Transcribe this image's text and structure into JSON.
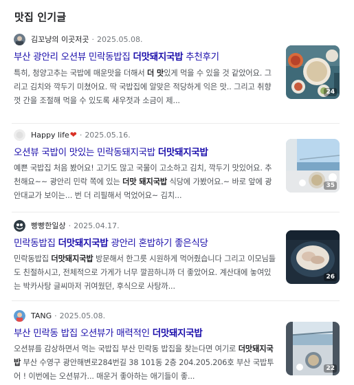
{
  "section": {
    "title": "맛집 인기글"
  },
  "posts": [
    {
      "author": "김꼬냥의 이곳저곳",
      "date": "2025.05.08.",
      "title_parts": [
        "부산 광안리 오션뷰 민락동밥집 ",
        "더맛돼지국밥",
        " 추천후기"
      ],
      "snippet": [
        "특히, 청양고추는 국밥에 매운맛을 더해서 ",
        "더 맛",
        "있게 먹을 수 있을 것 같았어요. 그리고 김치와 깍두기 미쳤어요. 딱 국밥집에 알맞은 적당하게 익은 맛.. 그리고 취향껏 간을 조절해 먹을 수 있도록 새우젓과 소금이 제..."
      ],
      "image_count": "24",
      "thumb_icon": "food-photo-icon"
    },
    {
      "author": "Happy life",
      "date": "2025.05.16.",
      "title_parts": [
        "오션뷰 국밥이 맛있는 민락동돼지국밥 ",
        "더맛돼지국밥",
        ""
      ],
      "snippet": [
        "예쁜 국밥집 처음 봤어요! 고기도 많고 국물이 고소하고 김치, 깍두기 맛있어요. 추천해요~~ 광안리 민락 쪽에 있는 ",
        "더맛 돼지국밥",
        " 식당에 가봤어요.~ 바로 앞에 광안대교가 보이는... 번 더 리필해서 먹었어요~ 김치..."
      ],
      "image_count": "35",
      "thumb_icon": "ocean-view-photo-icon"
    },
    {
      "author": "빵빵한일상",
      "date": "2025.04.17.",
      "title_parts": [
        "민락동밥집 ",
        "더맛돼지국밥",
        " 광안리 혼밥하기 좋은식당"
      ],
      "snippet": [
        "민락동밥집 ",
        "더맛돼지국밥",
        " 방문해서 한그릇 시원하게 먹어줬습니다 그리고 이모님들도 친절하시고, 전체적으로 가게가 너무 깔끔하니까 더 좋았어요. 계산대에 놓여있는 박카사탕 글씨마저 귀여웠던, 후식으로 사탕까..."
      ],
      "image_count": "26",
      "thumb_icon": "meat-dish-photo-icon"
    },
    {
      "author": "TANG",
      "date": "2025.05.08.",
      "title_parts": [
        "부산 민락동 밥집 오션뷰가 매력적인 ",
        "더맛돼지국밥",
        ""
      ],
      "snippet": [
        "오션뷰를 감상하면서 먹는 국밥집 부산 민락동 밥집을 찾는다면 여기로 ",
        "더맛돼지국밥",
        " 부산 수영구 광안해변로284번길 38 101동 2층 204.205.206호 부산 국밥투어 ! 이번에는 오션뷰가... 매운거 좋아하는 애기들이 좋..."
      ],
      "image_count": "22",
      "thumb_icon": "bridge-view-photo-icon"
    }
  ]
}
